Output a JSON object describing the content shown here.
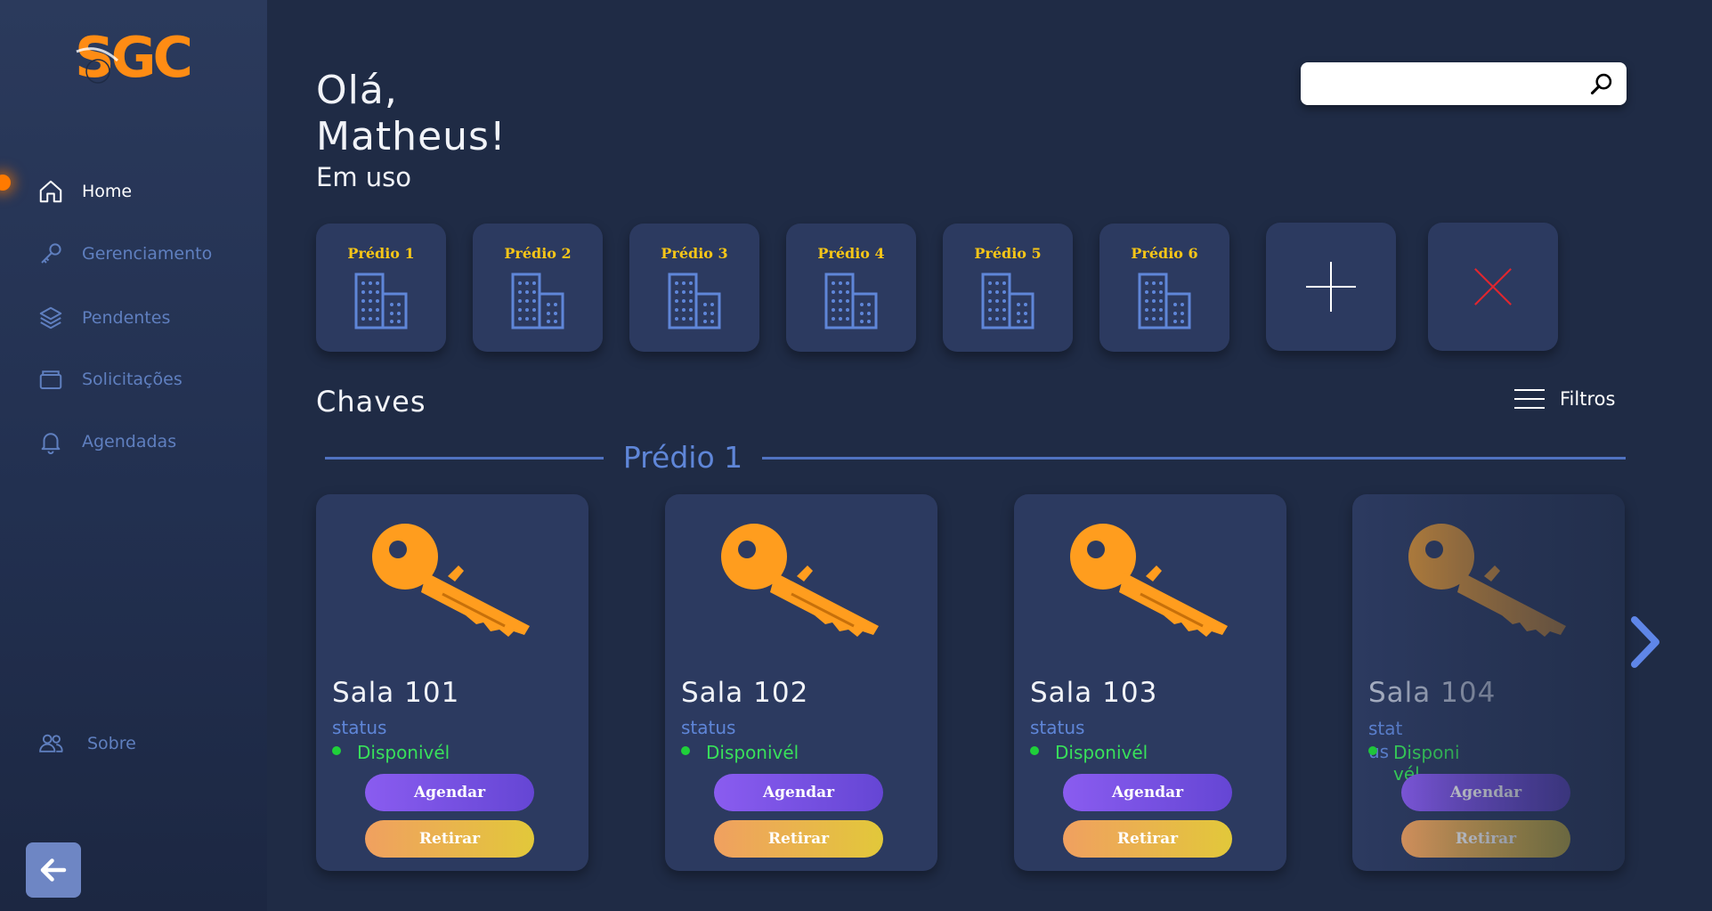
{
  "app": {
    "logo_text": "SGC",
    "accent": "#ff7a00"
  },
  "sidebar": {
    "items": [
      {
        "label": "Home",
        "icon": "home-icon",
        "active": true
      },
      {
        "label": "Gerenciamento",
        "icon": "key-icon",
        "active": false
      },
      {
        "label": "Pendentes",
        "icon": "layers-icon",
        "active": false
      },
      {
        "label": "Solicitações",
        "icon": "folder-icon",
        "active": false
      },
      {
        "label": "Agendadas",
        "icon": "bell-icon",
        "active": false
      }
    ],
    "about_label": "Sobre",
    "back_icon": "arrow-left-icon"
  },
  "header": {
    "greeting_line1": "Olá,",
    "greeting_line2": "Matheus!",
    "section_in_use": "Em uso",
    "search_placeholder": ""
  },
  "buildings": [
    {
      "label": "Prédio 1"
    },
    {
      "label": "Prédio 2"
    },
    {
      "label": "Prédio 3"
    },
    {
      "label": "Prédio 4"
    },
    {
      "label": "Prédio 5"
    },
    {
      "label": "Prédio 6"
    }
  ],
  "keys_section": {
    "title": "Chaves",
    "filters_label": "Filtros",
    "group_label": "Prédio 1",
    "cards": [
      {
        "room": "Sala 101",
        "status_label": "status",
        "status_value": "Disponivél",
        "schedule_label": "Agendar",
        "withdraw_label": "Retirar"
      },
      {
        "room": "Sala 102",
        "status_label": "status",
        "status_value": "Disponivél",
        "schedule_label": "Agendar",
        "withdraw_label": "Retirar"
      },
      {
        "room": "Sala 103",
        "status_label": "status",
        "status_value": "Disponivél",
        "schedule_label": "Agendar",
        "withdraw_label": "Retirar"
      },
      {
        "room": "Sala 104",
        "status_label": "status",
        "status_value": "Disponivél",
        "schedule_label": "Agendar",
        "withdraw_label": "Retirar"
      }
    ]
  },
  "colors": {
    "background": "#1f2b45",
    "card": "#2c3a60",
    "building_label": "#f5c518",
    "status_available": "#38e05a",
    "agendar": "#7a52e6",
    "retirar": "#e9b04e",
    "key": "#ff9d1e"
  }
}
